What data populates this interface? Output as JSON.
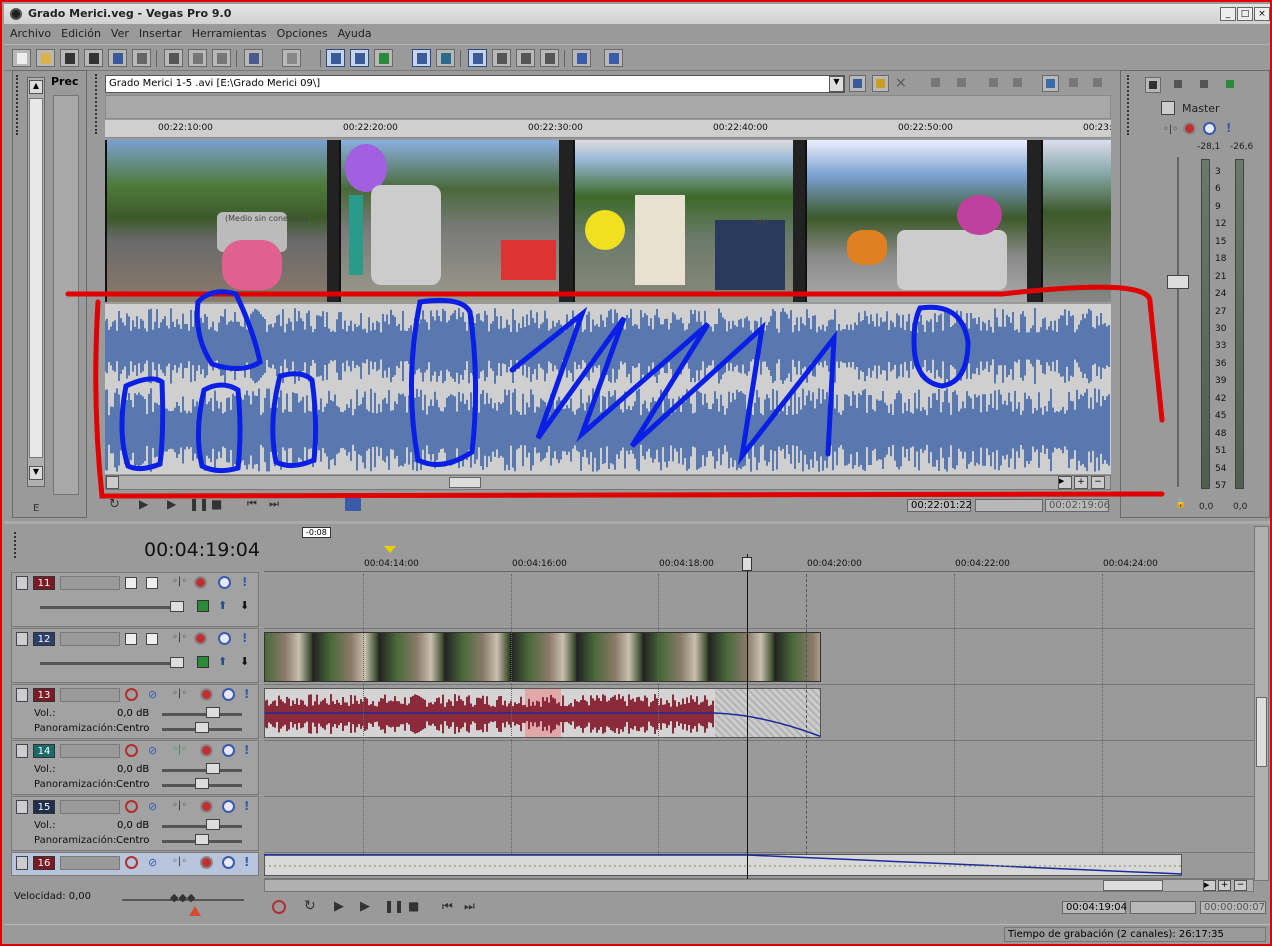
{
  "window": {
    "title": "Grado Merici.veg - Vegas Pro 9.0"
  },
  "menu": [
    "Archivo",
    "Edición",
    "Ver",
    "Insertar",
    "Herramientas",
    "Opciones",
    "Ayuda"
  ],
  "side_tab": {
    "label": "Prec",
    "hint": "E"
  },
  "trimmer": {
    "clip_path": "Grado Merici  1-5 .avi    [E:\\Grado Merici 09\\]",
    "ruler_ticks": [
      "00:22:10:00",
      "00:22:20:00",
      "00:22:30:00",
      "00:22:40:00",
      "00:22:50:00",
      "00:23:"
    ],
    "thumb_overlay": "(Medio sin conexión)",
    "thumb_overlay2": "sin",
    "position": "00:22:01:22",
    "length": "00:02:19:06"
  },
  "master": {
    "label": "Master",
    "peak_left": "-28,1",
    "peak_right": "-26,6",
    "scale": [
      "3",
      "6",
      "9",
      "12",
      "15",
      "18",
      "21",
      "24",
      "27",
      "30",
      "33",
      "36",
      "39",
      "42",
      "45",
      "48",
      "51",
      "54",
      "57"
    ],
    "level_left": "0,0",
    "level_right": "0,0"
  },
  "timeline": {
    "cursor_time": "00:04:19:04",
    "marker_label": "-0:08",
    "ruler_ticks": [
      "00:04:14:00",
      "00:04:16:00",
      "00:04:18:00",
      "00:04:20:00",
      "00:04:22:00",
      "00:04:24:00"
    ],
    "time_in": "00:04:19:04",
    "time_length": "00:00:00:07"
  },
  "tracks": [
    {
      "num": "11",
      "type": "video",
      "color": "#7a1a24"
    },
    {
      "num": "12",
      "type": "video",
      "color": "#2a3f6a"
    },
    {
      "num": "13",
      "type": "audio",
      "color": "#7a1a24",
      "vol_label": "Vol.:",
      "vol": "0,0 dB",
      "pan_label": "Panoramización:",
      "pan": "Centro"
    },
    {
      "num": "14",
      "type": "audio",
      "color": "#1a6a6a",
      "vol_label": "Vol.:",
      "vol": "0,0 dB",
      "pan_label": "Panoramización:",
      "pan": "Centro"
    },
    {
      "num": "15",
      "type": "audio",
      "color": "#1f2f4f",
      "vol_label": "Vol.:",
      "vol": "0,0 dB",
      "pan_label": "Panoramización:",
      "pan": "Centro"
    },
    {
      "num": "16",
      "type": "audio",
      "color": "#7a1a24"
    }
  ],
  "speed_label": "Velocidad: 0,00",
  "status": {
    "recording": "Tiempo de grabación (2 canales): 26:17:35"
  },
  "colors": {
    "annotation_red": "#e00000",
    "annotation_blue": "#0a1fe6",
    "wave_blue": "#5a78b0",
    "wave_red": "#8a2a3a"
  }
}
